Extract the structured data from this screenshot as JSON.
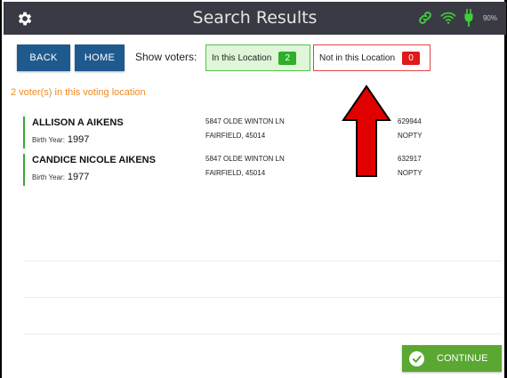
{
  "header": {
    "title": "Search Results",
    "settings_icon": "gear-icon",
    "status": {
      "link_icon": "link-icon",
      "wifi_icon": "wifi-icon",
      "power_icon": "power-plug-icon",
      "battery_percent": "90%"
    },
    "colors": {
      "bar": "#3a3a44",
      "status_green": "#3fcf3a"
    }
  },
  "toolbar": {
    "back_label": "BACK",
    "home_label": "HOME",
    "show_voters_label": "Show voters:",
    "in_location": {
      "label": "In this Location",
      "count": "2"
    },
    "not_in_location": {
      "label": "Not in this Location",
      "count": "0"
    }
  },
  "summary": "2 voter(s) in this voting location",
  "voters": [
    {
      "name": "ALLISON A AIKENS",
      "birth_label": "Birth Year:",
      "birth_year": "1997",
      "address_line1": "5847 OLDE WINTON LN",
      "address_line2": "FAIRFIELD, 45014",
      "voter_id": "629944",
      "party": "NOPTY"
    },
    {
      "name": "CANDICE NICOLE AIKENS",
      "birth_label": "Birth Year:",
      "birth_year": "1977",
      "address_line1": "5847 OLDE WINTON LN",
      "address_line2": "FAIRFIELD, 45014",
      "voter_id": "632917",
      "party": "NOPTY"
    }
  ],
  "annotation": {
    "icon": "red-arrow-up-icon",
    "color": "#e00000"
  },
  "footer": {
    "continue_label": "CONTINUE",
    "continue_color": "#5aa832"
  }
}
